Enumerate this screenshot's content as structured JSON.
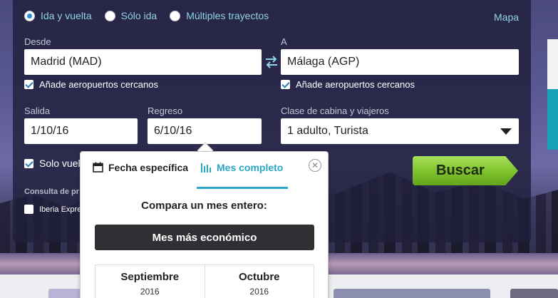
{
  "trip_types": [
    {
      "label": "Ida y vuelta",
      "selected": true
    },
    {
      "label": "Sólo ida",
      "selected": false
    },
    {
      "label": "Múltiples trayectos",
      "selected": false
    }
  ],
  "map_link": "Mapa",
  "origin": {
    "label": "Desde",
    "value": "Madrid (MAD)",
    "nearby_label": "Añade aeropuertos cercanos",
    "nearby_checked": true
  },
  "destination": {
    "label": "A",
    "value": "Málaga (AGP)",
    "nearby_label": "Añade aeropuertos cercanos",
    "nearby_checked": true
  },
  "departure": {
    "label": "Salida",
    "value": "1/10/16"
  },
  "return": {
    "label": "Regreso",
    "value": "6/10/16"
  },
  "cabin": {
    "label": "Clase de cabina y viajeros",
    "value": "1 adulto, Turista"
  },
  "search_button": "Buscar",
  "direct_only": {
    "label": "Solo vuelo",
    "checked": true
  },
  "consulta_label": "Consulta de pr",
  "airline_option": {
    "label": "Iberia Expre",
    "checked": false
  },
  "popover": {
    "tabs": [
      {
        "label": "Fecha específica",
        "icon": "calendar-icon",
        "active": false
      },
      {
        "label": "Mes completo",
        "icon": "bar-chart-icon",
        "active": true
      }
    ],
    "close_icon": "close-icon",
    "compare_title": "Compara un mes entero:",
    "cheapest_button": "Mes más económico",
    "months": [
      {
        "name": "Septiembre",
        "year": "2016"
      },
      {
        "name": "Octubre",
        "year": "2016"
      }
    ]
  },
  "colors": {
    "link": "#8fd3e6",
    "accent": "#2aa6c6",
    "search_button": "#7dc12c",
    "panel": "#201e3a"
  }
}
